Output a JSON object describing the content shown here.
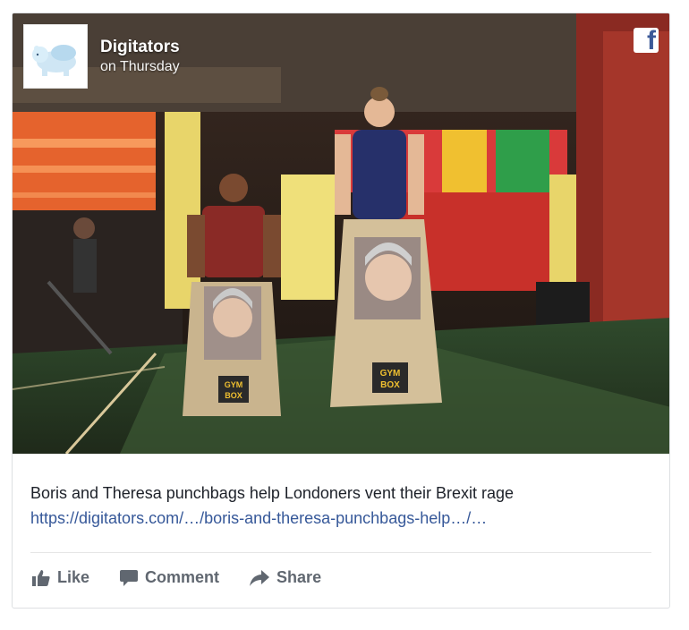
{
  "post": {
    "page_name": "Digitators",
    "time": "on Thursday",
    "social_icon": "facebook-icon",
    "headline": "Boris and Theresa punchbags help Londoners vent their Brexit rage",
    "link": "https://digitators.com/…/boris-and-theresa-punchbags-help…/…"
  },
  "photo": {
    "bag_text_line1": "GYM",
    "bag_text_line2": "BOX"
  },
  "actions": {
    "like": "Like",
    "comment": "Comment",
    "share": "Share"
  },
  "colors": {
    "link": "#365899",
    "action_text": "#606770",
    "brand": "#3b5998"
  }
}
